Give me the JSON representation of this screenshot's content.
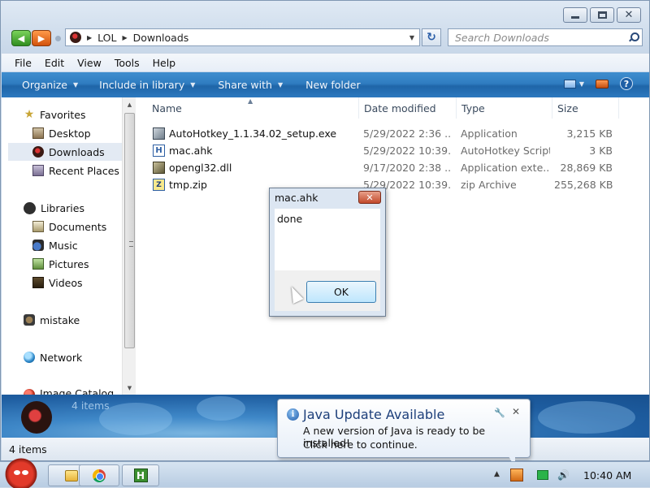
{
  "window": {
    "address": {
      "crumbs": [
        "LOL",
        "Downloads"
      ]
    },
    "search_placeholder": "Search Downloads"
  },
  "menu": [
    "File",
    "Edit",
    "View",
    "Tools",
    "Help"
  ],
  "commands": [
    "Organize",
    "Include in library",
    "Share with",
    "New folder"
  ],
  "nav": {
    "favorites": "Favorites",
    "desktop": "Desktop",
    "downloads": "Downloads",
    "recent": "Recent Places",
    "libraries": "Libraries",
    "documents": "Documents",
    "music": "Music",
    "pictures": "Pictures",
    "videos": "Videos",
    "mistake": "mistake",
    "network": "Network",
    "catalog": "Image Catalog"
  },
  "columns": {
    "name": "Name",
    "date": "Date modified",
    "type": "Type",
    "size": "Size"
  },
  "files": [
    {
      "name": "AutoHotkey_1.1.34.02_setup.exe",
      "date": "5/29/2022 2:36 ...",
      "type": "Application",
      "size": "3,215 KB",
      "icon": "installer-icon"
    },
    {
      "name": "mac.ahk",
      "date": "5/29/2022 10:39...",
      "type": "AutoHotkey Script",
      "size": "3 KB",
      "icon": "ahk-script-icon"
    },
    {
      "name": "opengl32.dll",
      "date": "9/17/2020 2:38 ...",
      "type": "Application exte...",
      "size": "28,869 KB",
      "icon": "dll-icon"
    },
    {
      "name": "tmp.zip",
      "date": "5/29/2022 10:39...",
      "type": "zip Archive",
      "size": "255,268 KB",
      "icon": "zip-icon"
    }
  ],
  "details": {
    "count": "4 items"
  },
  "status": {
    "count": "4 items"
  },
  "dialog": {
    "title": "mac.ahk",
    "message": "done",
    "ok": "OK"
  },
  "balloon": {
    "title": "Java Update Available",
    "line1": "A new version of Java is ready to be installed!",
    "line2": "Click here to continue."
  },
  "taskbar": {
    "clock": "10:40 AM"
  },
  "colors": {
    "command_bar": "#2f7cc0",
    "selection": "#e3eaf3",
    "dialog_close": "#c24a2c"
  }
}
